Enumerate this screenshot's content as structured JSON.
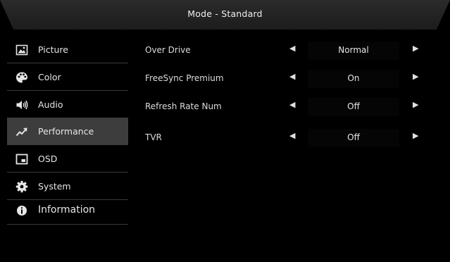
{
  "header": {
    "title": "Mode - Standard"
  },
  "sidebar": {
    "items": [
      {
        "label": "Picture",
        "icon": "picture-icon",
        "active": false
      },
      {
        "label": "Color",
        "icon": "palette-icon",
        "active": false
      },
      {
        "label": "Audio",
        "icon": "speaker-icon",
        "active": false
      },
      {
        "label": "Performance",
        "icon": "trend-arrow-icon",
        "active": true
      },
      {
        "label": "OSD",
        "icon": "osd-window-icon",
        "active": false
      },
      {
        "label": "System",
        "icon": "gear-icon",
        "active": false
      },
      {
        "label": "Information",
        "icon": "info-icon",
        "active": false
      }
    ]
  },
  "settings": [
    {
      "label": "Over Drive",
      "value": "Normal"
    },
    {
      "label": "FreeSync Premium",
      "value": "On"
    },
    {
      "label": "Refresh Rate Num",
      "value": "Off"
    },
    {
      "label": "TVR",
      "value": "Off"
    }
  ],
  "colors": {
    "background": "#000000",
    "active_item": "#3d3d3d",
    "text": "#e6e6e6"
  }
}
